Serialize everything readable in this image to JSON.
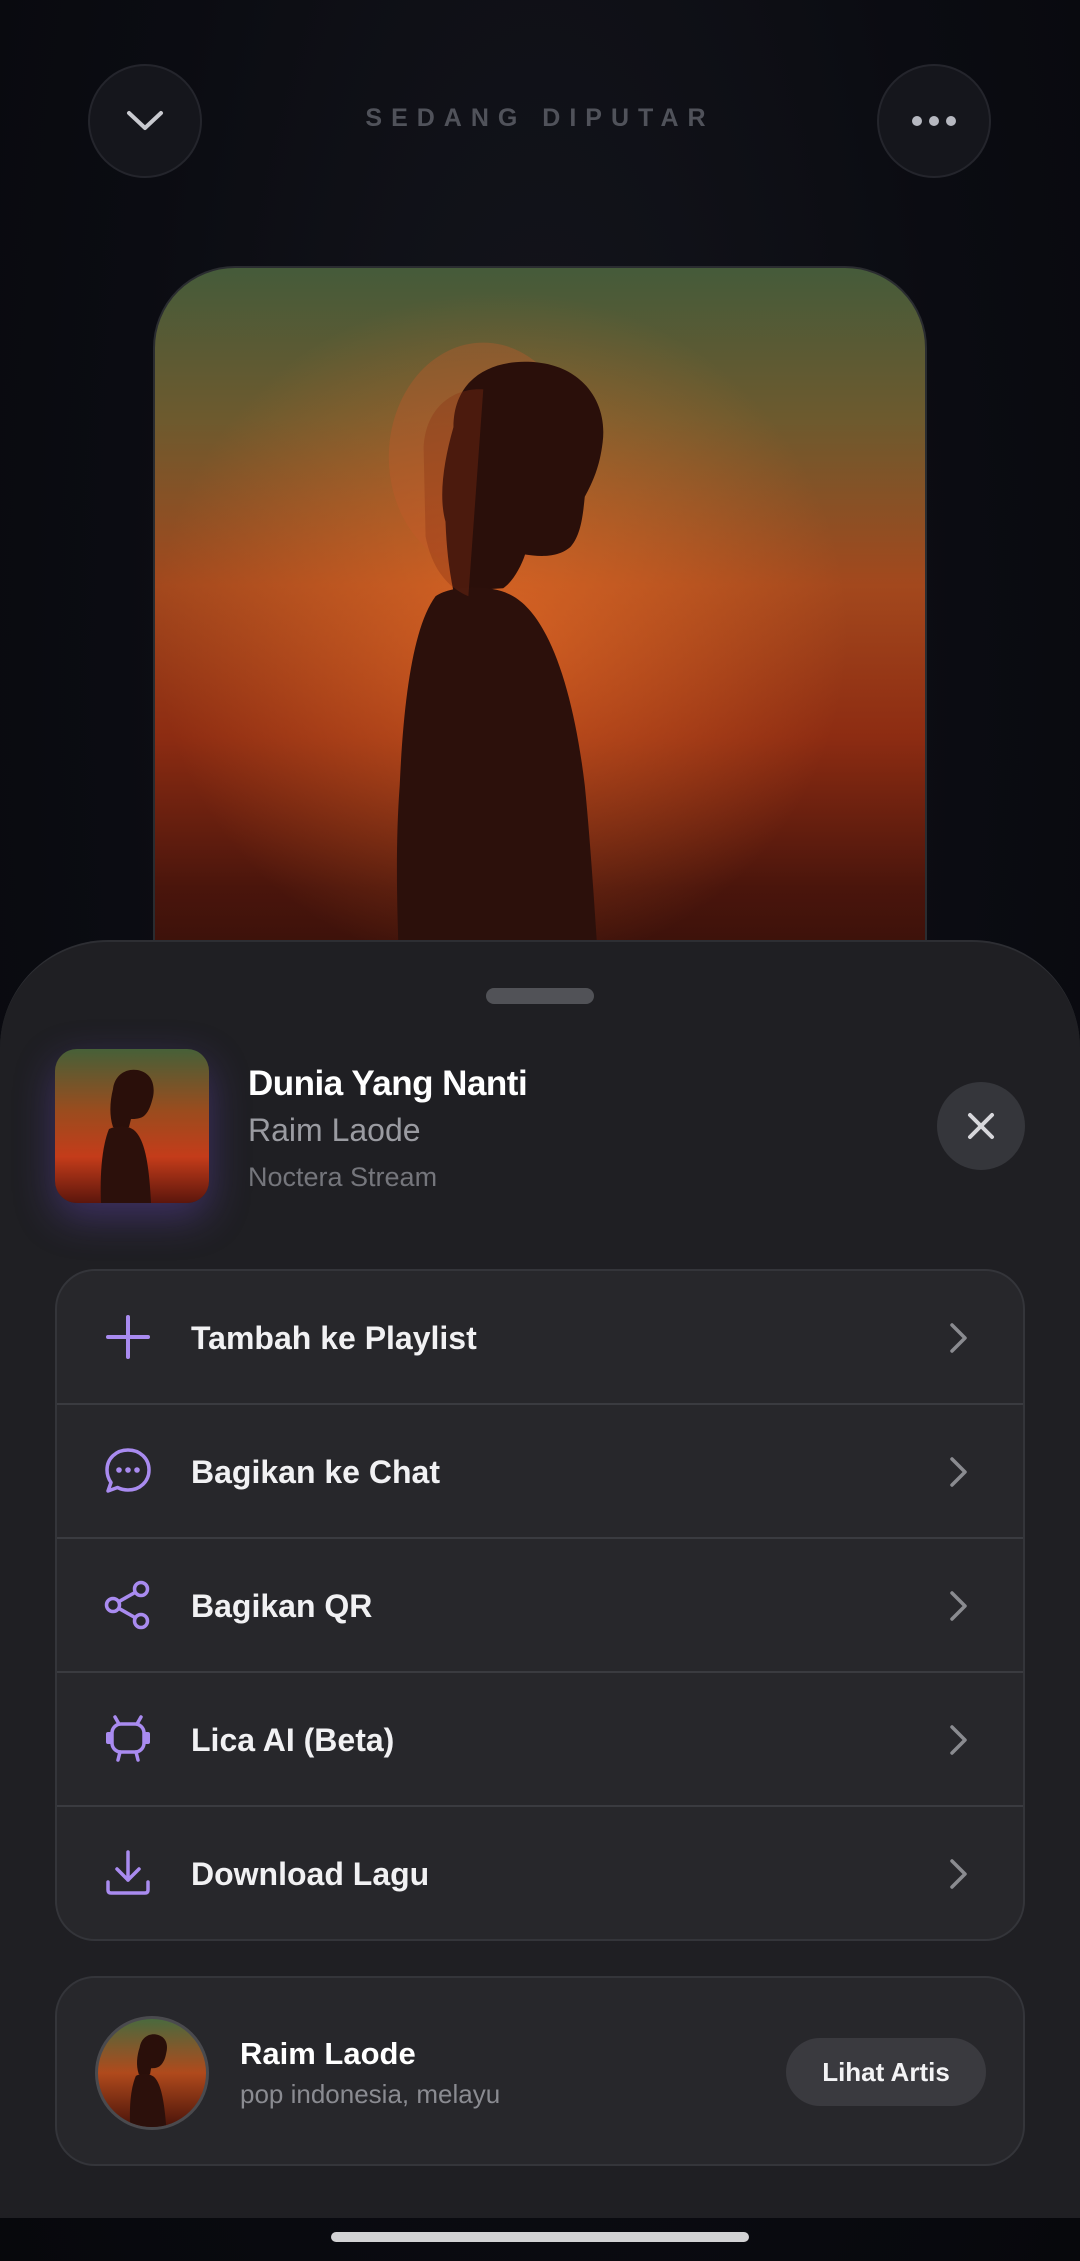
{
  "now_playing": {
    "title": "SEDANG DIPUTAR",
    "collapse_icon": "chevron-down-icon",
    "more_icon": "more-horizontal-icon"
  },
  "sheet": {
    "song": {
      "title": "Dunia Yang Nanti",
      "artist": "Raim Laode",
      "source": "Noctera Stream"
    },
    "close_icon": "close-icon",
    "menu": [
      {
        "label": "Tambah ke Playlist",
        "icon": "plus-icon"
      },
      {
        "label": "Bagikan ke Chat",
        "icon": "chat-bubble-icon"
      },
      {
        "label": "Bagikan QR",
        "icon": "share-icon"
      },
      {
        "label": "Lica AI (Beta)",
        "icon": "robot-icon"
      },
      {
        "label": "Download Lagu",
        "icon": "download-icon"
      }
    ],
    "artist_card": {
      "name": "Raim Laode",
      "genres": "pop indonesia, melayu",
      "button_label": "Lihat Artis"
    }
  },
  "colors": {
    "accent": "#a98bf0",
    "sheet_bg": "#1f1f23",
    "card_bg": "#27272b",
    "button_bg": "#3a3a3f"
  }
}
